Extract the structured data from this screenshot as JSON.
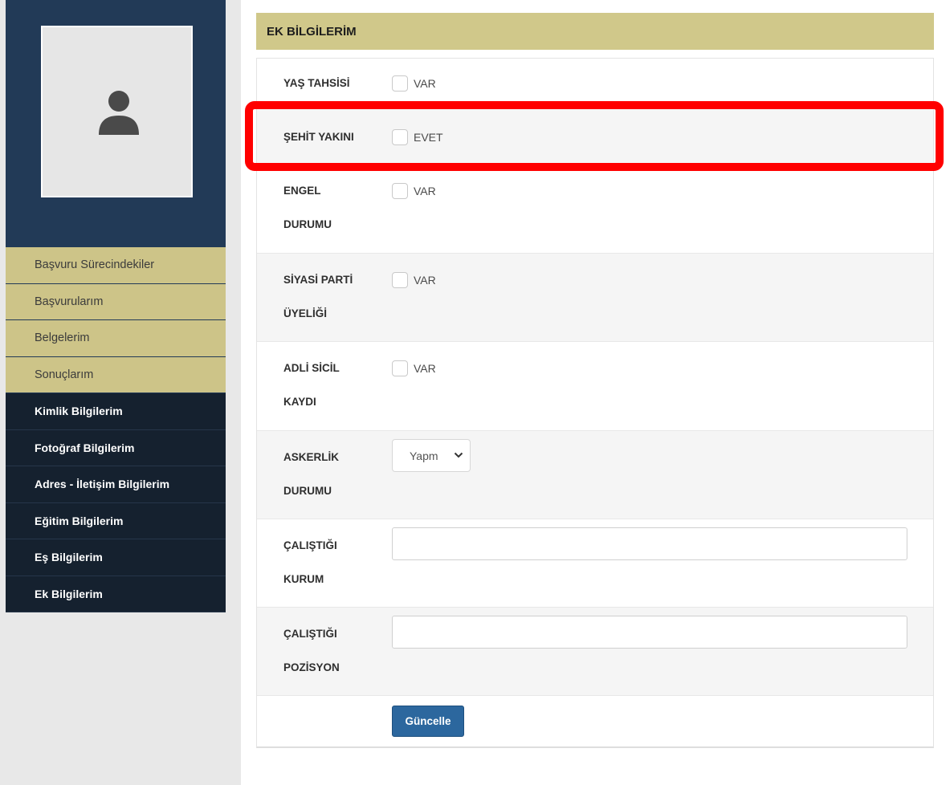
{
  "sidebar": {
    "menu_gold": [
      {
        "label": "Başvuru Sürecindekiler"
      },
      {
        "label": "Başvurularım"
      },
      {
        "label": "Belgelerim"
      },
      {
        "label": "Sonuçlarım"
      }
    ],
    "menu_dark": [
      {
        "label": "Kimlik Bilgilerim"
      },
      {
        "label": "Fotoğraf Bilgilerim"
      },
      {
        "label": "Adres - İletişim Bilgilerim"
      },
      {
        "label": "Eğitim Bilgilerim"
      },
      {
        "label": "Eş Bilgilerim"
      },
      {
        "label": "Ek Bilgilerim"
      }
    ]
  },
  "form": {
    "title": "EK BİLGİLERİM",
    "yas_tahsisi": {
      "label": "YAŞ TAHSİSİ",
      "option": "VAR"
    },
    "sehit_yakini": {
      "label": "ŞEHİT YAKINI",
      "option": "EVET"
    },
    "engel_durumu": {
      "label1": "ENGEL",
      "label2": "DURUMU",
      "option": "VAR"
    },
    "siyasi_parti": {
      "label1": "SİYASİ PARTİ",
      "label2": "ÜYELİĞİ",
      "option": "VAR"
    },
    "adli_sicil": {
      "label1": "ADLİ SİCİL",
      "label2": "KAYDI",
      "option": "VAR"
    },
    "askerlik": {
      "label1": "ASKERLİK",
      "label2": "DURUMU",
      "selected": "Yapm"
    },
    "calistigi_kurum": {
      "label1": "ÇALIŞTIĞI",
      "label2": "KURUM",
      "value": ""
    },
    "calistigi_pozisyon": {
      "label1": "ÇALIŞTIĞI",
      "label2": "POZİSYON",
      "value": ""
    },
    "submit_label": "Güncelle"
  },
  "colors": {
    "sidebar_top": "#223a57",
    "menu_gold": "#cdc488",
    "menu_dark": "#15212f",
    "header_gold": "#d0c88a",
    "button_blue": "#2c679e",
    "highlight_red": "#ff0000"
  },
  "icons": {
    "avatar": "user-silhouette-icon",
    "select_arrow": "chevron-down-icon"
  }
}
